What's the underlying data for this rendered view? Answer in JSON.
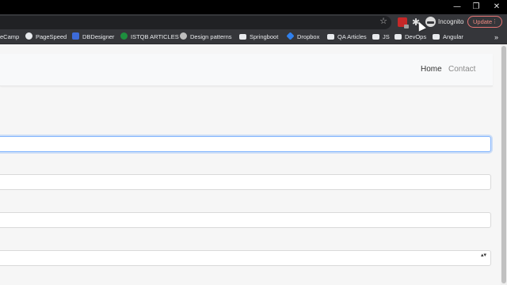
{
  "window": {
    "controls": {
      "minimize": "—",
      "maximize": "❐",
      "close": "✕"
    }
  },
  "toolbar": {
    "star_icon": "star-icon",
    "profile_label": "Incognito",
    "update_label": "Update",
    "update_menu": "⋮"
  },
  "bookmarks": {
    "items": [
      {
        "label": "eCamp",
        "icon": "none"
      },
      {
        "label": "PageSpeed",
        "icon": "pagespeed-icon"
      },
      {
        "label": "DBDesigner",
        "icon": "dbdesigner-icon"
      },
      {
        "label": "ISTQB ARTICLES",
        "icon": "check-icon"
      },
      {
        "label": "Design patterns",
        "icon": "globe-icon"
      },
      {
        "label": "Springboot",
        "icon": "folder-icon"
      },
      {
        "label": "Dropbox",
        "icon": "dropbox-icon"
      },
      {
        "label": "QA Articles",
        "icon": "folder-icon"
      },
      {
        "label": "JS",
        "icon": "folder-icon"
      },
      {
        "label": "DevOps",
        "icon": "folder-icon"
      },
      {
        "label": "Angular",
        "icon": "folder-icon"
      }
    ],
    "more": "»"
  },
  "navbar": {
    "links": [
      {
        "label": "Home",
        "active": true
      },
      {
        "label": "Contact",
        "active": false
      }
    ]
  },
  "form": {
    "fields": [
      {
        "type": "text",
        "value": "",
        "focused": true
      },
      {
        "type": "text",
        "value": ""
      },
      {
        "type": "text",
        "value": ""
      },
      {
        "type": "select",
        "value": ""
      }
    ],
    "select_arrows": "▴▾"
  },
  "colors": {
    "chrome_bg": "#35363a",
    "focus_ring": "#86b7fe",
    "update_accent": "#f28b82"
  }
}
